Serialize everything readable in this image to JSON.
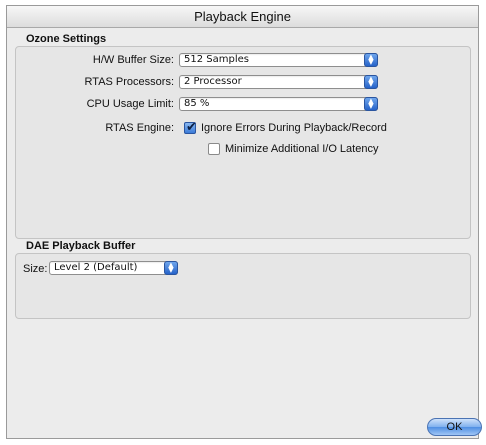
{
  "window": {
    "title": "Playback Engine"
  },
  "ozone": {
    "section_title": "Ozone Settings",
    "hw_buffer": {
      "label": "H/W Buffer Size:",
      "value": "512 Samples"
    },
    "rtas_processors": {
      "label": "RTAS Processors:",
      "value": "2 Processor"
    },
    "cpu_usage": {
      "label": "CPU Usage Limit:",
      "value": "85 %"
    },
    "rtas_engine": {
      "label": "RTAS Engine:",
      "ignore_errors": {
        "label": "Ignore Errors During Playback/Record",
        "checked": true
      },
      "minimize_latency": {
        "label": "Minimize Additional I/O Latency",
        "checked": false
      }
    }
  },
  "dae": {
    "section_title": "DAE Playback Buffer",
    "size": {
      "label": "Size:",
      "value": "Level 2 (Default)"
    }
  },
  "buttons": {
    "ok": "OK"
  },
  "icons": {
    "popup_arrows": "updown-arrows-icon",
    "checkmark": "checkmark-icon"
  },
  "colors": {
    "accent": "#2663c9",
    "background": "#ececec"
  }
}
